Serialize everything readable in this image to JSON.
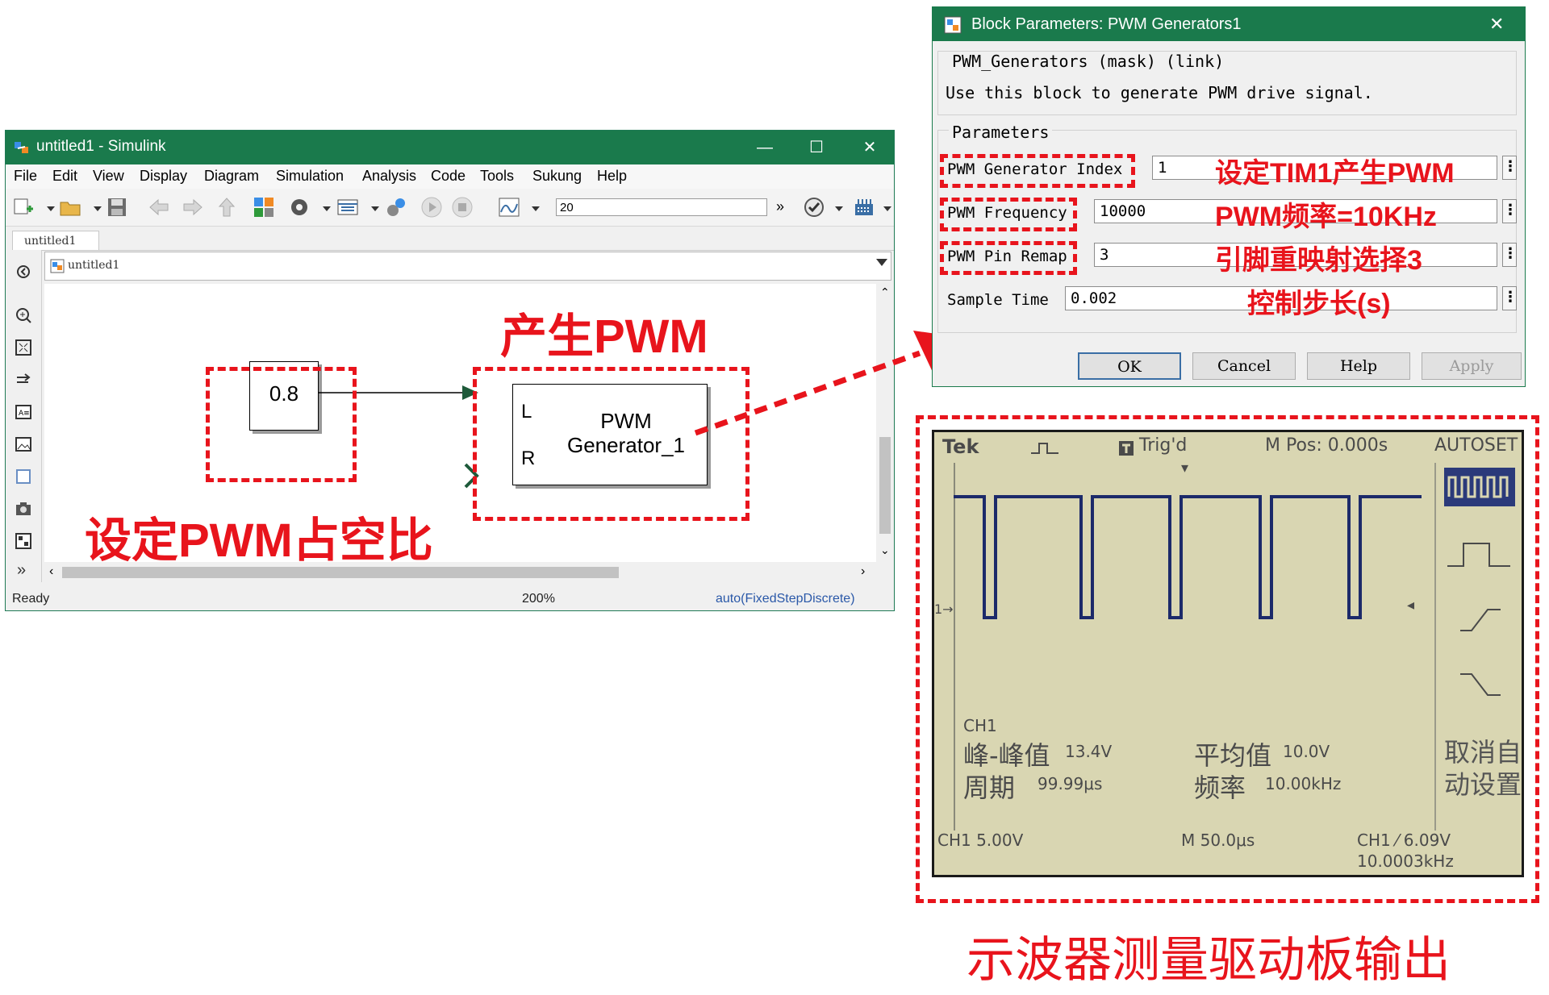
{
  "simulink": {
    "title": "untitled1 - Simulink",
    "window_controls": {
      "minimize": "—",
      "maximize": "☐",
      "close": "✕"
    },
    "menu": [
      "File",
      "Edit",
      "View",
      "Display",
      "Diagram",
      "Simulation",
      "Analysis",
      "Code",
      "Tools",
      "Sukung",
      "Help"
    ],
    "stop_time": "20",
    "more_label": "»",
    "tab": "untitled1",
    "address": "untitled1",
    "blocks": {
      "constant_value": "0.8",
      "pwm_line1": "PWM",
      "pwm_line2": "Generator_1",
      "port_l": "L",
      "port_r": "R"
    },
    "status": {
      "left": "Ready",
      "zoom": "200%",
      "solver": "auto(FixedStepDiscrete)"
    }
  },
  "dialog": {
    "title": "Block Parameters: PWM Generators1",
    "close": "✕",
    "mask_line": "PWM_Generators (mask) (link)",
    "description": "Use this block to generate PWM drive signal.",
    "parameters_label": "Parameters",
    "params": [
      {
        "label": "PWM Generator Index",
        "value": "1",
        "note": "设定TIM1产生PWM"
      },
      {
        "label": "PWM Frequency",
        "value": "10000",
        "note": "PWM频率=10KHz"
      },
      {
        "label": "PWM Pin Remap",
        "value": "3",
        "note": "引脚重映射选择3"
      },
      {
        "label": "Sample Time",
        "value": "0.002",
        "note": "控制步长(s)"
      }
    ],
    "more": "⋮",
    "buttons": {
      "ok": "OK",
      "cancel": "Cancel",
      "help": "Help",
      "apply": "Apply"
    }
  },
  "annotations": {
    "generate_pwm": "产生PWM",
    "duty_cycle": "设定PWM占空比",
    "scope_caption": "示波器测量驱动板输出"
  },
  "scope": {
    "brand": "Tek",
    "trigger_state": "Trig'd",
    "m_pos": "M Pos: 0.000s",
    "autoset": "AUTOSET",
    "ch1_marker": "1→",
    "channel": "CH1",
    "pk_pk_label": "峰-峰值",
    "pk_pk_value": "13.4V",
    "mean_label": "平均值",
    "mean_value": "10.0V",
    "period_label": "周期",
    "period_value": "99.99μs",
    "freq_label": "频率",
    "freq_value": "10.00kHz",
    "cancel_autoset_line1": "取消自",
    "cancel_autoset_line2": "动设置",
    "ch1_scale": "CH1 5.00V",
    "timebase": "M 50.0μs",
    "trigger_level": "CH1 ⁄ 6.09V",
    "trigger_freq": "10.0003kHz"
  },
  "colors": {
    "titlebar": "#1a7a4c",
    "annotation_red": "#e8141c",
    "scope_screen": "#d9d6b2",
    "trace": "#1c2a6a"
  }
}
